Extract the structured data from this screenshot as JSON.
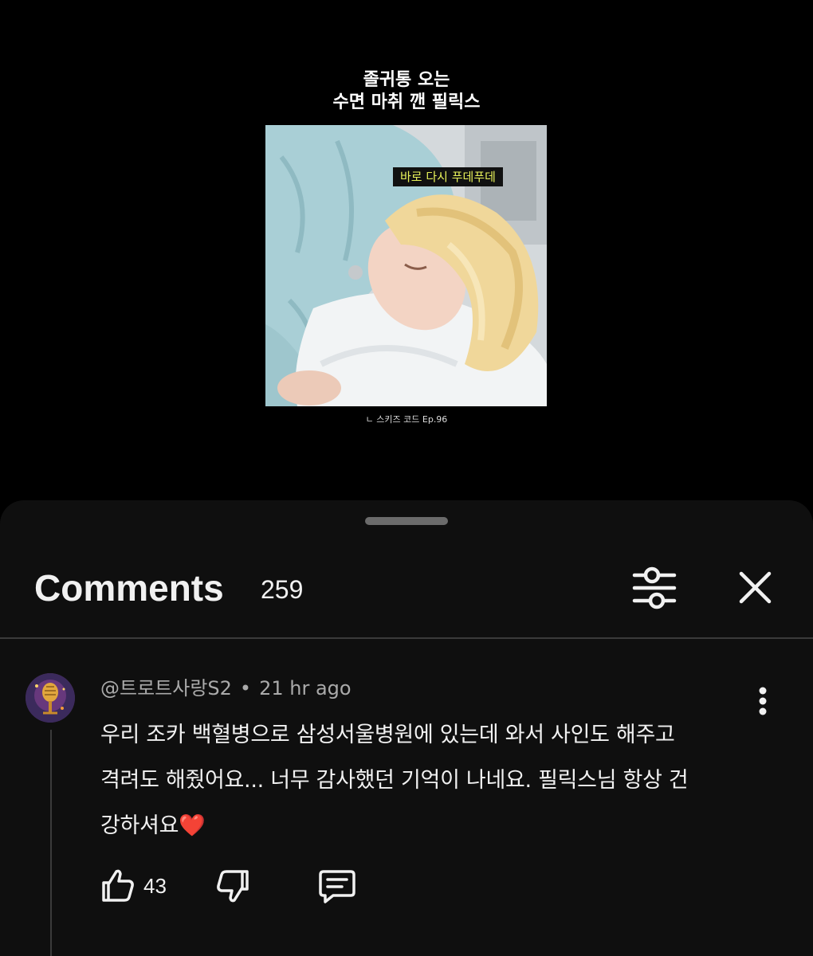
{
  "video": {
    "title_line1": "졸귀통 오는",
    "title_line2": "수면 마취 깬 필릭스",
    "caption": "바로 다시 푸데푸데",
    "source_credit": "ㄴ 스키즈 코드 Ep.96"
  },
  "comments_panel": {
    "title": "Comments",
    "count": "259",
    "icons": {
      "filter": "sliders-icon",
      "close": "close-icon"
    }
  },
  "comment": {
    "author": "@트로트사랑S2",
    "separator": "•",
    "time": "21 hr ago",
    "body_line1": "우리 조카 백혈병으로 삼성서울병원에 있는데 와서 사인도 해주고",
    "body_line2": "격려도 해줬어요... 너무 감사했던 기억이 나네요. 필릭스님 항상 건",
    "body_line3": "강하셔요",
    "emoji": "❤️",
    "likes": "43",
    "icons": {
      "avatar": "microphone-avatar",
      "more": "more-vertical-icon",
      "like": "thumbs-up-icon",
      "dislike": "thumbs-down-icon",
      "reply": "reply-icon"
    }
  },
  "colors": {
    "sheet_background": "#0f0f0f",
    "caption_text": "#e8f25a",
    "secondary_text": "#aaaaaa",
    "heart": "#e0212d"
  }
}
